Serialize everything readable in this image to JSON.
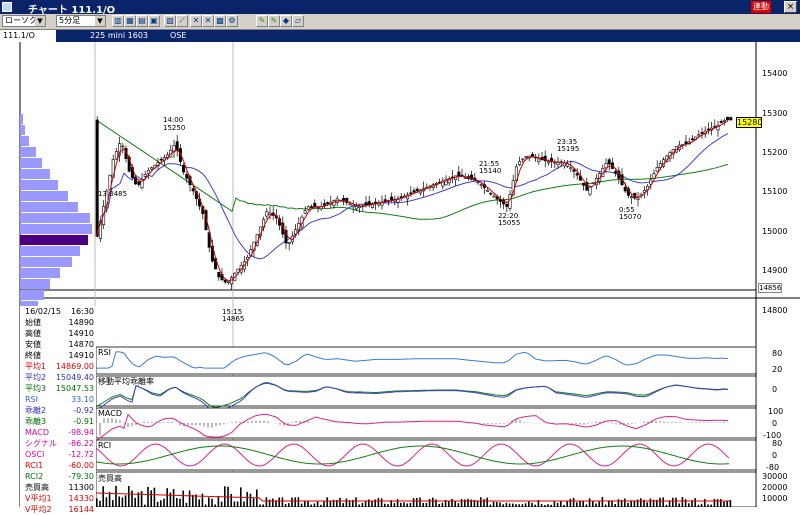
{
  "window": {
    "title": "チャート 111.1/O",
    "link_badge": "連動",
    "close_label": "×"
  },
  "toolbar": {
    "mode_select": "ローソク",
    "interval_select": "5分足",
    "icons": [
      "bar-chart-icon",
      "grid-icon",
      "table-icon",
      "zoom-icon",
      "compare-icon",
      "trend-icon",
      "cross-icon",
      "x-icon",
      "calc-icon",
      "pencil-icon",
      "pencil-green-icon",
      "paint-icon",
      "eraser-icon",
      "settings-icon"
    ]
  },
  "infobar": {
    "symbol": "111.1/O",
    "contract": "225 mini 1603",
    "market": "OSE"
  },
  "price_axis": [
    "15400",
    "15300",
    "15200",
    "15100",
    "15000",
    "14900",
    "14800"
  ],
  "current_price": "15280",
  "low_marker": "14856",
  "annotations": [
    {
      "time": "14:00",
      "price": "15250"
    },
    {
      "time": "13:0485",
      "price": ""
    },
    {
      "time": "21:55",
      "price": "15140"
    },
    {
      "time": "22:20",
      "price": "15055"
    },
    {
      "time": "23:35",
      "price": "15195"
    },
    {
      "time": "0:55",
      "price": "15070"
    },
    {
      "time": "15:15",
      "price": "14865"
    }
  ],
  "info_panel": {
    "date": "16/02/15",
    "time": "16:30",
    "rows": [
      {
        "k": "始値",
        "v": "14890",
        "color": "#000000"
      },
      {
        "k": "高値",
        "v": "14910",
        "color": "#000000"
      },
      {
        "k": "安値",
        "v": "14870",
        "color": "#000000"
      },
      {
        "k": "終値",
        "v": "14910",
        "color": "#000000"
      },
      {
        "k": "平均1",
        "v": "14869.00",
        "color": "#e00000"
      },
      {
        "k": "平均2",
        "v": "15049.40",
        "color": "#3030c0"
      },
      {
        "k": "平均3",
        "v": "15047.53",
        "color": "#007000"
      },
      {
        "k": "RSI",
        "v": "33.10",
        "color": "#3060d0"
      },
      {
        "k": "乖離2",
        "v": "-0.92",
        "color": "#3030c0"
      },
      {
        "k": "乖離3",
        "v": "-0.91",
        "color": "#007000"
      },
      {
        "k": "MACD",
        "v": "-98.94",
        "color": "#e000a0"
      },
      {
        "k": "シグナル",
        "v": "-86.22",
        "color": "#e000a0"
      },
      {
        "k": "OSCI",
        "v": "-12.72",
        "color": "#e000a0"
      },
      {
        "k": "RCI1",
        "v": "-60.00",
        "color": "#e00000"
      },
      {
        "k": "RCI2",
        "v": "-79.30",
        "color": "#007000"
      },
      {
        "k": "売買高",
        "v": "11300",
        "color": "#000000"
      },
      {
        "k": "V平均1",
        "v": "14330",
        "color": "#e00000"
      },
      {
        "k": "V平均2",
        "v": "16144",
        "color": "#e00000"
      }
    ]
  },
  "subpanels": [
    {
      "name": "RSI",
      "ticks": [
        "80",
        "20"
      ]
    },
    {
      "name": "移動平均乖離率",
      "ticks": [
        "0"
      ]
    },
    {
      "name": "MACD",
      "ticks": [
        "100",
        "0",
        "-100"
      ]
    },
    {
      "name": "RCI",
      "ticks": [
        "80",
        "0",
        "-80"
      ]
    },
    {
      "name": "売買高",
      "ticks": [
        "30000",
        "20000",
        "10000"
      ]
    }
  ],
  "colors": {
    "title_bg": "#0a246a",
    "ma1": "#d00000",
    "ma2": "#4040d0",
    "ma3": "#108010",
    "volume_profile": "#9999ff",
    "volume_profile_peak": "#4b0082",
    "rsi": "#3a7bd5",
    "rci1": "#e0208a",
    "rci2": "#108010"
  }
}
